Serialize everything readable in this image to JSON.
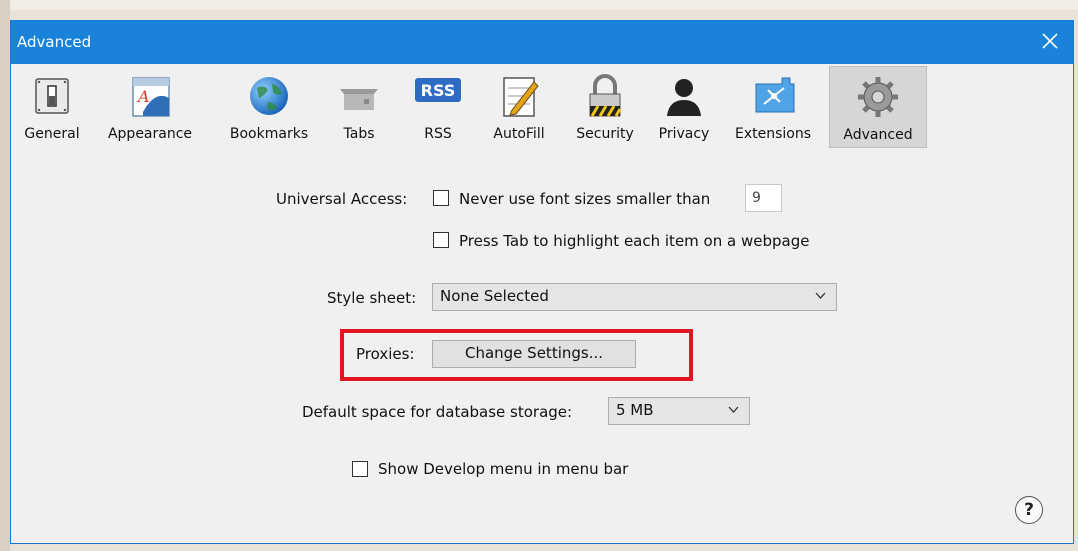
{
  "window": {
    "title": "Advanced"
  },
  "toolbar": {
    "items": [
      {
        "label": "General",
        "icon": "switch-icon"
      },
      {
        "label": "Appearance",
        "icon": "appearance-icon"
      },
      {
        "label": "Bookmarks",
        "icon": "globe-icon"
      },
      {
        "label": "Tabs",
        "icon": "tabs-icon"
      },
      {
        "label": "RSS",
        "icon": "rss-icon",
        "badge": "RSS"
      },
      {
        "label": "AutoFill",
        "icon": "pencil-form-icon"
      },
      {
        "label": "Security",
        "icon": "padlock-icon"
      },
      {
        "label": "Privacy",
        "icon": "person-silhouette-icon"
      },
      {
        "label": "Extensions",
        "icon": "compass-puzzle-icon"
      },
      {
        "label": "Advanced",
        "icon": "gears-icon"
      }
    ],
    "selected": "Advanced"
  },
  "settings": {
    "universal_access_label": "Universal Access:",
    "never_use_font_label": "Never use font sizes smaller than",
    "font_size_value": "9",
    "press_tab_label": "Press Tab to highlight each item on a webpage",
    "style_sheet_label": "Style sheet:",
    "style_sheet_value": "None Selected",
    "proxies_label": "Proxies:",
    "change_settings_label": "Change Settings...",
    "db_storage_label": "Default space for database storage:",
    "db_storage_value": "5 MB",
    "develop_menu_label": "Show Develop menu in menu bar",
    "help_label": "?"
  },
  "colors": {
    "titlebar": "#1983d9",
    "highlight_box": "#e1141f"
  }
}
